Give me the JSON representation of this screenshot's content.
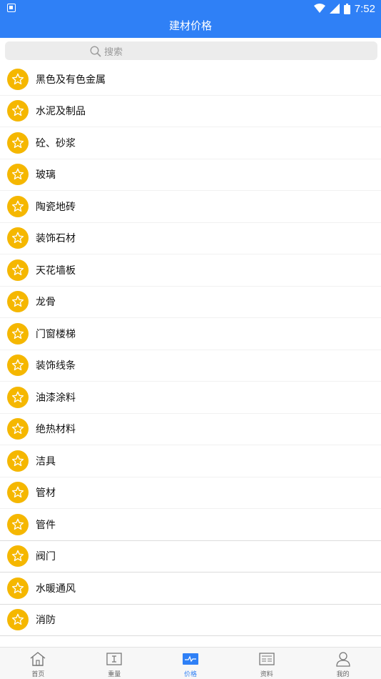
{
  "status_bar": {
    "time": "7:52"
  },
  "header": {
    "title": "建材价格"
  },
  "search": {
    "placeholder": "搜索"
  },
  "categories": [
    {
      "label": "黑色及有色金属"
    },
    {
      "label": "水泥及制品"
    },
    {
      "label": "砼、砂浆"
    },
    {
      "label": "玻璃"
    },
    {
      "label": "陶瓷地砖"
    },
    {
      "label": "装饰石材"
    },
    {
      "label": "天花墙板"
    },
    {
      "label": "龙骨"
    },
    {
      "label": "门窗楼梯"
    },
    {
      "label": "装饰线条"
    },
    {
      "label": "油漆涂料"
    },
    {
      "label": "绝热材料"
    },
    {
      "label": "洁具"
    },
    {
      "label": "管材"
    },
    {
      "label": "管件"
    },
    {
      "label": "阀门"
    },
    {
      "label": "水暖通风"
    },
    {
      "label": "消防"
    }
  ],
  "tabbar": {
    "tabs": [
      {
        "label": "首页",
        "icon": "home-icon"
      },
      {
        "label": "重量",
        "icon": "weight-icon"
      },
      {
        "label": "价格",
        "icon": "price-chart-icon",
        "active": true
      },
      {
        "label": "资料",
        "icon": "document-icon"
      },
      {
        "label": "我的",
        "icon": "profile-icon"
      }
    ]
  },
  "colors": {
    "primary": "#2f80f6",
    "star": "#f5b700"
  }
}
